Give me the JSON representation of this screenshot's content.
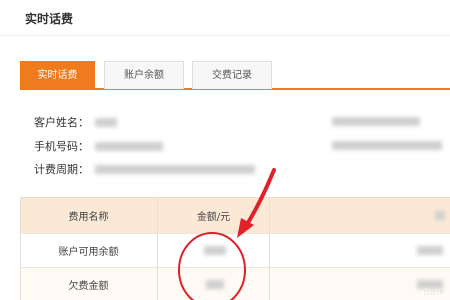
{
  "page": {
    "title": "实时话费"
  },
  "tabs": [
    {
      "label": "实时话费",
      "active": true
    },
    {
      "label": "账户余额",
      "active": false
    },
    {
      "label": "交费记录",
      "active": false
    }
  ],
  "info": {
    "customer_name_label": "客户姓名：",
    "phone_label": "手机号码：",
    "billing_period_label": "计费周期："
  },
  "table": {
    "headers": [
      "费用名称",
      "金额/元",
      ""
    ],
    "rows": [
      {
        "name": "账户可用余额"
      },
      {
        "name": "欠费金额"
      }
    ]
  },
  "colors": {
    "accent": "#f07b1d",
    "header_bg": "#fbe9d6",
    "annotation": "#e0202a"
  },
  "icons": {
    "annotation_arrow": "red-arrow-icon",
    "annotation_circle": "red-circle-icon"
  }
}
